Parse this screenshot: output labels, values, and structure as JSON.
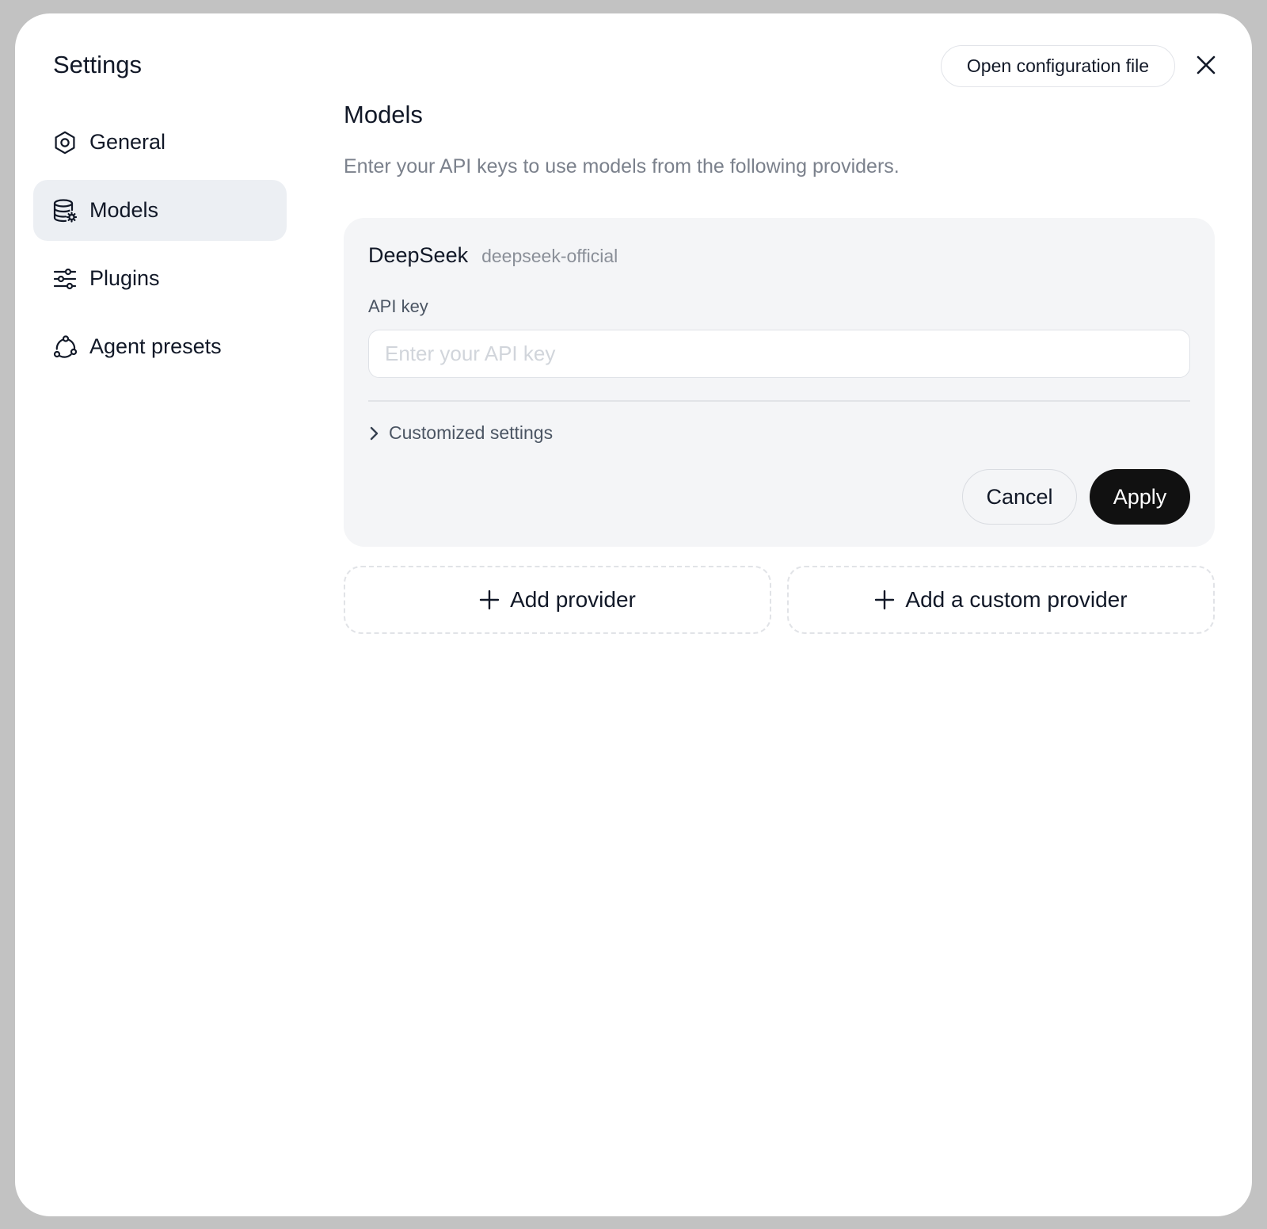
{
  "dialog": {
    "title": "Settings",
    "open_config_label": "Open configuration file",
    "close_icon": "close-icon"
  },
  "sidebar": {
    "items": [
      {
        "label": "General",
        "icon": "gear-icon",
        "active": false
      },
      {
        "label": "Models",
        "icon": "database-gear-icon",
        "active": true
      },
      {
        "label": "Plugins",
        "icon": "sliders-icon",
        "active": false
      },
      {
        "label": "Agent presets",
        "icon": "nodes-icon",
        "active": false
      }
    ]
  },
  "main": {
    "title": "Models",
    "description": "Enter your API keys to use models from the following providers.",
    "provider": {
      "name": "DeepSeek",
      "id": "deepseek-official",
      "api_key_label": "API key",
      "api_key_value": "",
      "api_key_placeholder": "Enter your API key",
      "customized_label": "Customized settings",
      "cancel_label": "Cancel",
      "apply_label": "Apply"
    },
    "add_provider_label": "Add provider",
    "add_custom_provider_label": "Add a custom provider"
  },
  "colors": {
    "backdrop": "#c2c2c2",
    "active_nav": "#eceff3",
    "card_bg": "#f4f5f7",
    "primary_button": "#111111",
    "muted_text": "#7b818c"
  }
}
